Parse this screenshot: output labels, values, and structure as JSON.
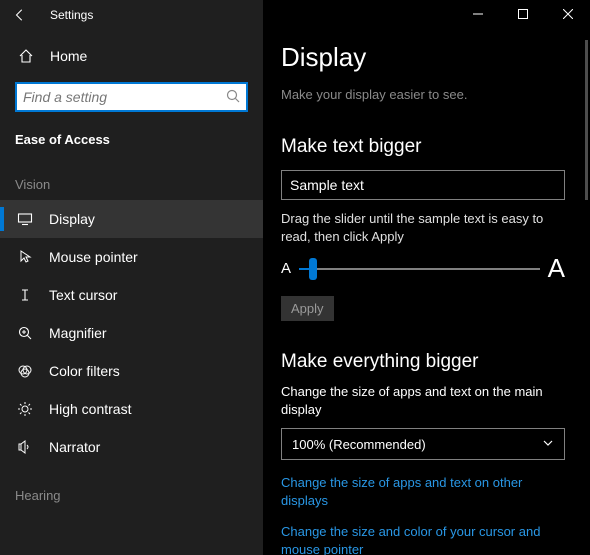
{
  "titlebar": {
    "app_name": "Settings"
  },
  "sidebar": {
    "home_label": "Home",
    "search_placeholder": "Find a setting",
    "group_label": "Ease of Access",
    "sections": {
      "vision_label": "Vision",
      "hearing_label": "Hearing"
    },
    "items": [
      {
        "label": "Display",
        "icon": "display"
      },
      {
        "label": "Mouse pointer",
        "icon": "mouse"
      },
      {
        "label": "Text cursor",
        "icon": "text-cursor"
      },
      {
        "label": "Magnifier",
        "icon": "magnifier"
      },
      {
        "label": "Color filters",
        "icon": "color-filters"
      },
      {
        "label": "High contrast",
        "icon": "high-contrast"
      },
      {
        "label": "Narrator",
        "icon": "narrator"
      }
    ]
  },
  "main": {
    "title": "Display",
    "subtitle": "Make your display easier to see.",
    "section_text_bigger": {
      "heading": "Make text bigger",
      "sample_text": "Sample text",
      "instruction": "Drag the slider until the sample text is easy to read, then click Apply",
      "small_a": "A",
      "big_a": "A",
      "apply_label": "Apply"
    },
    "section_everything_bigger": {
      "heading": "Make everything bigger",
      "description": "Change the size of apps and text on the main display",
      "scale_value": "100% (Recommended)",
      "link1": "Change the size of apps and text on other displays",
      "link2": "Change the size and color of your cursor and mouse pointer"
    }
  }
}
